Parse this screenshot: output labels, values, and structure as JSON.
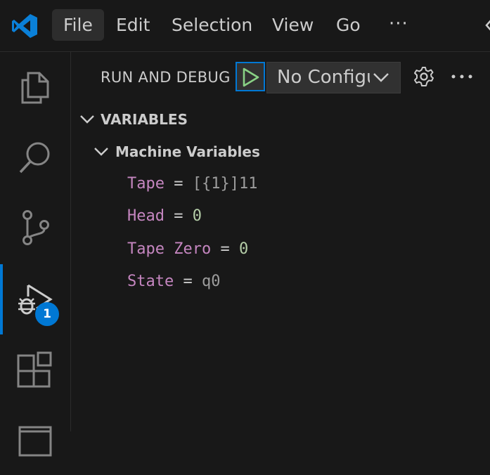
{
  "menu": {
    "items": [
      "File",
      "Edit",
      "Selection",
      "View",
      "Go"
    ],
    "more": "···"
  },
  "activity_bar": {
    "items": [
      "explorer-icon",
      "search-icon",
      "source-control-icon",
      "run-and-debug-icon",
      "extensions-icon",
      "panel-icon"
    ],
    "debug_badge": "1",
    "accent": "#0078d4"
  },
  "sidebar": {
    "title": "RUN AND DEBUG",
    "config_selected": "No Configurations",
    "variables_section": "VARIABLES",
    "scope": "Machine Variables",
    "variables": [
      {
        "name": "Tape",
        "eq": " = ",
        "value": "[{1}]11",
        "kind": "str"
      },
      {
        "name": "Head",
        "eq": " = ",
        "value": "0",
        "kind": "num"
      },
      {
        "name": "Tape Zero",
        "eq": " = ",
        "value": "0",
        "kind": "num"
      },
      {
        "name": "State",
        "eq": " = ",
        "value": "q0",
        "kind": "str"
      }
    ]
  },
  "colors": {
    "var_name": "#c586c0",
    "number": "#b5cea8",
    "string": "#9d9d9d",
    "run_green": "#89d185"
  }
}
